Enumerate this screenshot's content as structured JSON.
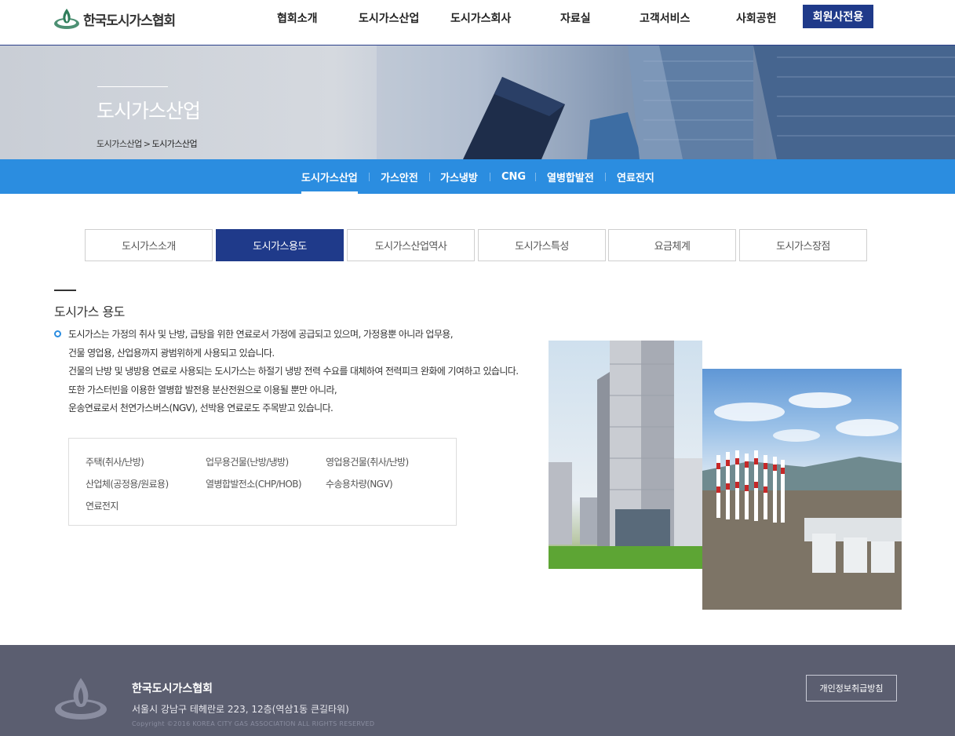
{
  "header": {
    "logo_text": "한국도시가스협회",
    "nav": [
      "협회소개",
      "도시가스산업",
      "도시가스회사",
      "자료실",
      "고객서비스",
      "사회공헌"
    ],
    "member_button": "회원사전용"
  },
  "hero": {
    "title": "도시가스산업",
    "breadcrumb": [
      "도시가스산업",
      "도시가스산업"
    ],
    "breadcrumb_sep": ">"
  },
  "subnav": {
    "items": [
      "도시가스산업",
      "가스안전",
      "가스냉방",
      "CNG",
      "열병합발전",
      "연료전지"
    ],
    "active_index": 0
  },
  "tabs": {
    "items": [
      "도시가스소개",
      "도시가스용도",
      "도시가스산업역사",
      "도시가스특성",
      "요금체계",
      "도시가스장점"
    ],
    "active_index": 1
  },
  "content": {
    "section_title": "도시가스 용도",
    "paragraph": [
      "도시가스는 가정의 취사 및 난방, 급탕을 위한 연료로서 가정에 공급되고 있으며, 가정용뿐 아니라 업무용,",
      "건물 영업용, 산업용까지 광범위하게 사용되고 있습니다.",
      "건물의 난방 및 냉방용 연료로 사용되는 도시가스는 하절기 냉방 전력 수요를 대체하여 전력피크 완화에 기여하고 있습니다.",
      "또한 가스터빈을 이용한 열병합 발전용 분산전원으로 이용될 뿐만 아니라,",
      "운송연료로서 천연가스버스(NGV), 선박용 연료로도 주목받고 있습니다."
    ],
    "uses": [
      "주택(취사/난방)",
      "업무용건물(난방/냉방)",
      "영업용건물(취사/난방)",
      "산업체(공정용/원료용)",
      "열병합발전소(CHP/HOB)",
      "수송용차량(NGV)",
      "연료전지"
    ]
  },
  "footer": {
    "name": "한국도시가스협회",
    "address": "서울시 강남구 테헤란로 223, 12층(역삼1동 큰길타워)",
    "copyright": "Copyright ©2016 KOREA CITY GAS ASSOCIATION ALL RIGHTS RESERVED",
    "privacy_button": "개인정보취급방침"
  },
  "colors": {
    "navy": "#1f3a8a",
    "subnav_blue": "#2b8de0",
    "footer_bg": "#5b5e70",
    "logo_green": "#2e7d5a"
  }
}
